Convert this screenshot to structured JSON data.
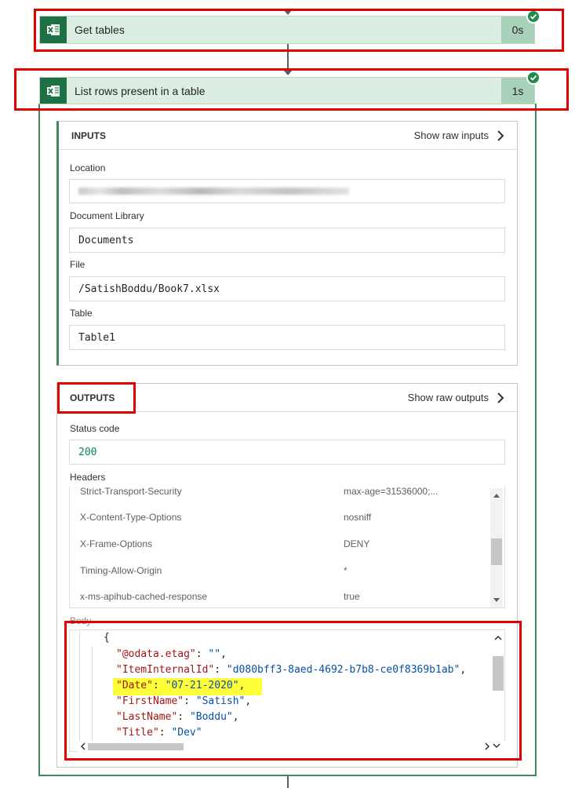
{
  "steps": [
    {
      "title": "Get tables",
      "duration": "0s",
      "icon": "excel-icon",
      "status": "succeeded"
    },
    {
      "title": "List rows present in a table",
      "duration": "1s",
      "icon": "excel-icon",
      "status": "succeeded"
    }
  ],
  "inputs": {
    "heading": "INPUTS",
    "show_raw": "Show raw inputs",
    "location_label": "Location",
    "document_library_label": "Document Library",
    "document_library_value": "Documents",
    "file_label": "File",
    "file_value": "/SatishBoddu/Book7.xlsx",
    "table_label": "Table",
    "table_value": "Table1"
  },
  "outputs": {
    "heading": "OUTPUTS",
    "show_raw": "Show raw outputs",
    "status_code_label": "Status code",
    "status_code_value": "200",
    "headers_label": "Headers",
    "headers": [
      {
        "name": "Strict-Transport-Security",
        "value": "max-age=31536000;..."
      },
      {
        "name": "X-Content-Type-Options",
        "value": "nosniff"
      },
      {
        "name": "X-Frame-Options",
        "value": "DENY"
      },
      {
        "name": "Timing-Allow-Origin",
        "value": "*"
      },
      {
        "name": "x-ms-apihub-cached-response",
        "value": "true"
      }
    ],
    "body_label": "Body",
    "body_lines": [
      {
        "key": "",
        "val": "",
        "raw": "{"
      },
      {
        "key": "\"@odata.etag\"",
        "val": "\"\""
      },
      {
        "key": "\"ItemInternalId\"",
        "val": "\"d080bff3-8aed-4692-b7b8-ce0f8369b1ab\""
      },
      {
        "key": "\"Date\"",
        "val": "\"07-21-2020\""
      },
      {
        "key": "\"FirstName\"",
        "val": "\"Satish\""
      },
      {
        "key": "\"LastName\"",
        "val": "\"Boddu\""
      },
      {
        "key": "\"Title\"",
        "val": "\"Dev\""
      },
      {
        "key": "",
        "val": "",
        "raw": "},"
      }
    ]
  },
  "colors": {
    "excel_green": "#1e7145",
    "highlight": "#ffff3a",
    "annotation_red": "#e00000"
  }
}
